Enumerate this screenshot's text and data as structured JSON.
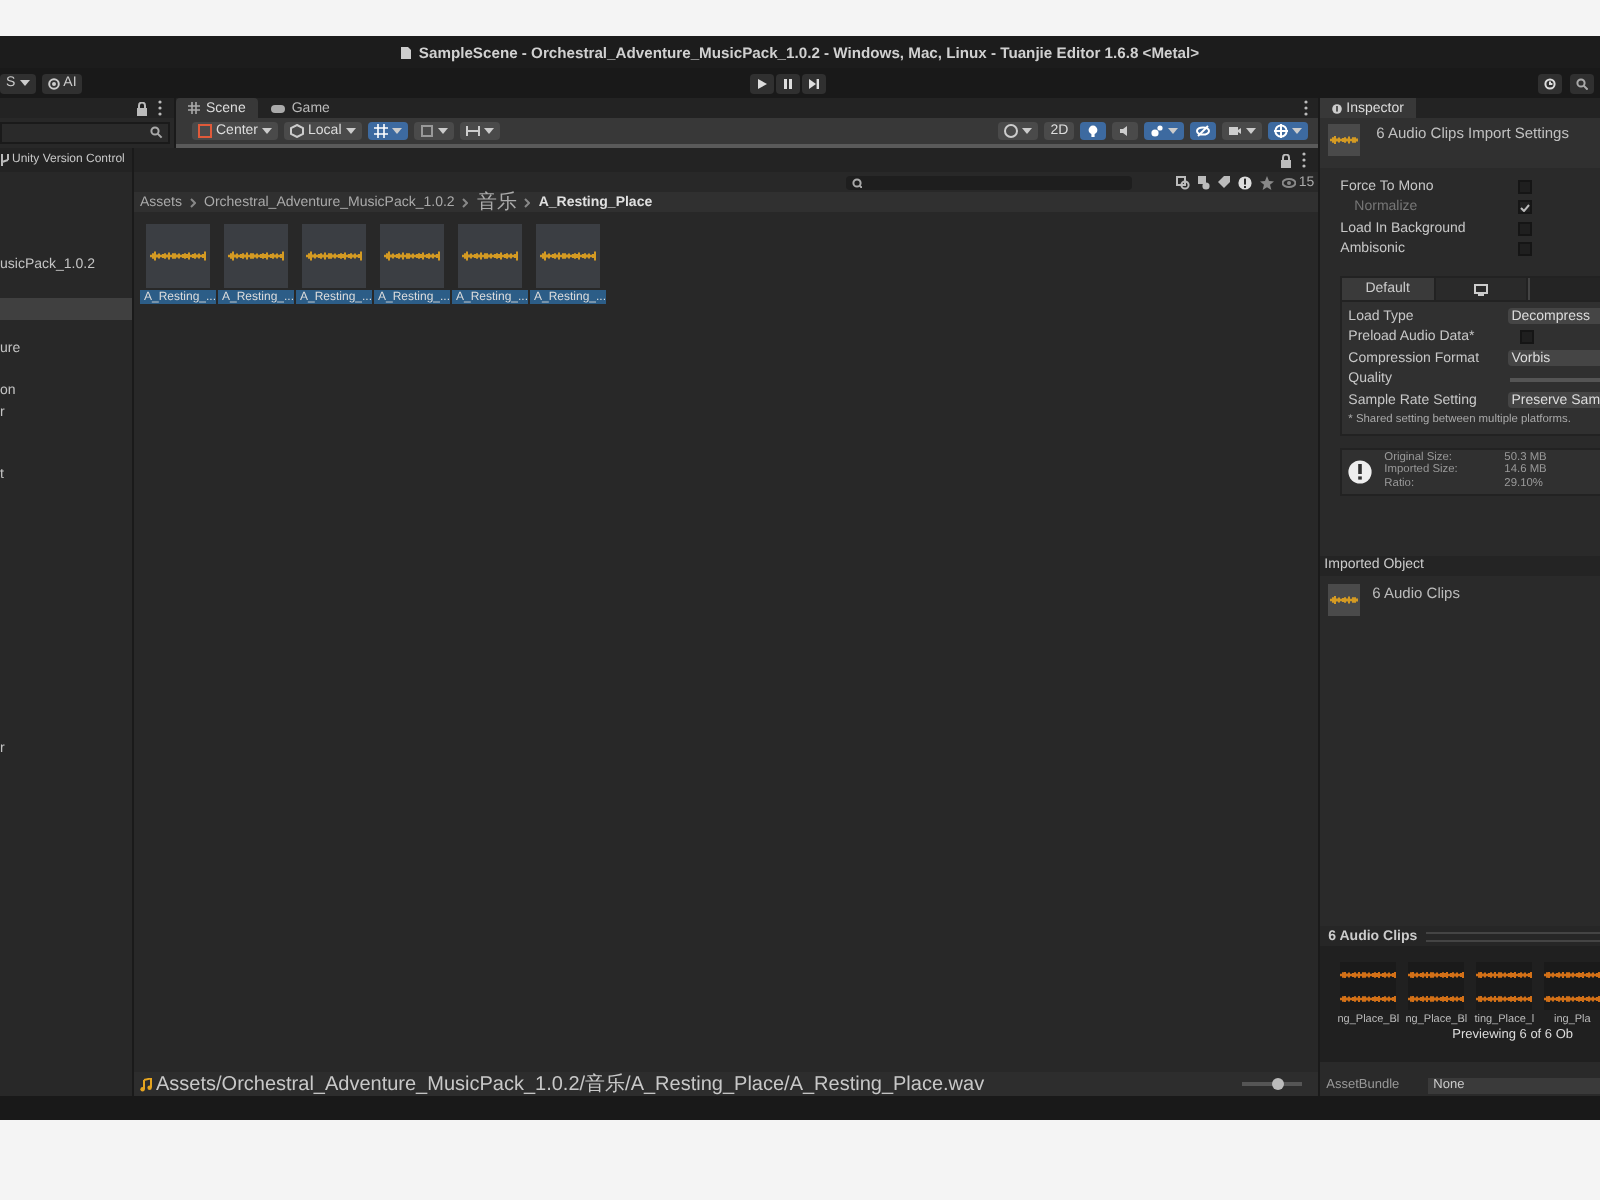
{
  "window": {
    "title": "SampleScene - Orchestral_Adventure_MusicPack_1.0.2 - Windows, Mac, Linux - Tuanjie Editor 1.6.8 <Metal>"
  },
  "toolbar": {
    "account_label": "S",
    "ai_button": "AI"
  },
  "scene_view": {
    "tabs": [
      {
        "label": "Scene",
        "selected": true
      },
      {
        "label": "Game",
        "selected": false
      }
    ],
    "pivot_button": "Center",
    "space_button": "Local",
    "mode_2d_button": "2D"
  },
  "project": {
    "header": "Unity Version Control",
    "item_count": "15",
    "folder_tree": [
      {
        "label": "usicPack_1.0.2",
        "selected": false
      },
      {
        "selected": true
      },
      {
        "label": "ure",
        "selected": false
      },
      {
        "label": "on",
        "selected": false
      },
      {
        "label": "r",
        "selected": false
      },
      {
        "label": "t",
        "selected": false
      },
      {
        "label": "r",
        "selected": false
      }
    ],
    "breadcrumb": [
      {
        "label": "Assets",
        "current": false
      },
      {
        "label": "Orchestral_Adventure_MusicPack_1.0.2",
        "current": false
      },
      {
        "label": "音乐",
        "current": false
      },
      {
        "label": "A_Resting_Place",
        "current": true
      }
    ],
    "assets": [
      {
        "label": "A_Resting_...",
        "selected": true
      },
      {
        "label": "A_Resting_...",
        "selected": true
      },
      {
        "label": "A_Resting_...",
        "selected": true
      },
      {
        "label": "A_Resting_...",
        "selected": true
      },
      {
        "label": "A_Resting_...",
        "selected": true
      },
      {
        "label": "A_Resting_...",
        "selected": true
      }
    ],
    "path": "Assets/Orchestral_Adventure_MusicPack_1.0.2/音乐/A_Resting_Place/A_Resting_Place.wav",
    "zoom_slider": {
      "level": 0.6
    }
  },
  "inspector": {
    "tab": "Inspector",
    "title": "6 Audio Clips Import Settings",
    "toggles": [
      {
        "label": "Force To Mono",
        "checked": false,
        "disabled": false
      },
      {
        "label": "Normalize",
        "checked": true,
        "disabled": true
      },
      {
        "label": "Load In Background",
        "checked": false,
        "disabled": false
      },
      {
        "label": "Ambisonic",
        "checked": false,
        "disabled": false
      }
    ],
    "platform_tabs": [
      {
        "kind": "text",
        "label": "Default",
        "selected": true
      },
      {
        "kind": "monitor",
        "selected": false
      },
      {
        "kind": "blank",
        "selected": false
      }
    ],
    "settings": [
      {
        "kind": "dropdown",
        "label": "Load Type",
        "value": "Decompress"
      },
      {
        "kind": "checkbox",
        "label": "Preload Audio Data*",
        "checked": false
      },
      {
        "kind": "dropdown",
        "label": "Compression Format",
        "value": "Vorbis"
      },
      {
        "kind": "slider",
        "label": "Quality"
      },
      {
        "kind": "dropdown",
        "label": "Sample Rate Setting",
        "value": "Preserve Sam"
      }
    ],
    "note": "* Shared setting between multiple platforms.",
    "size_info": [
      {
        "label": "Original Size:",
        "value": "50.3 MB"
      },
      {
        "label": "Imported Size:",
        "value": "14.6 MB"
      },
      {
        "label": "Ratio:",
        "value": "29.10%"
      }
    ],
    "imported_object": {
      "header": "Imported Object",
      "name": "6 Audio Clips"
    },
    "preview": {
      "header": "6 Audio Clips",
      "clips": [
        "ng_Place_Bl",
        "ng_Place_Bl",
        "ting_Place_l",
        "ing_Pla"
      ],
      "caption": "Previewing 6 of 6 Ob"
    },
    "asset_bundle": {
      "label": "AssetBundle",
      "value": "None"
    }
  }
}
